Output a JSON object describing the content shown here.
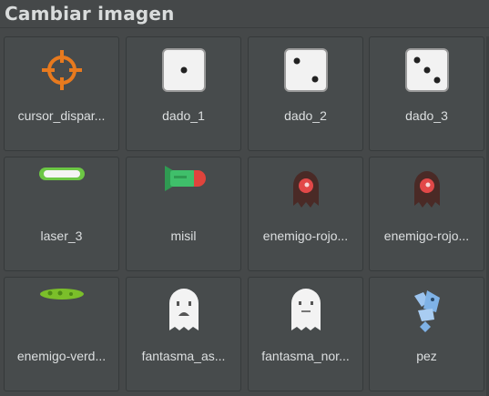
{
  "dialog": {
    "title": "Cambiar imagen"
  },
  "assets": [
    {
      "label": "cursor_dispar...",
      "icon": "crosshair-icon"
    },
    {
      "label": "dado_1",
      "icon": "die-one-icon"
    },
    {
      "label": "dado_2",
      "icon": "die-two-icon"
    },
    {
      "label": "dado_3",
      "icon": "die-three-icon"
    },
    {
      "label": "laser_3",
      "icon": "laser-icon"
    },
    {
      "label": "misil",
      "icon": "missile-icon"
    },
    {
      "label": "enemigo-rojo...",
      "icon": "red-enemy-icon"
    },
    {
      "label": "enemigo-rojo...",
      "icon": "red-enemy-icon"
    },
    {
      "label": "enemigo-verd...",
      "icon": "green-enemy-icon"
    },
    {
      "label": "fantasma_as...",
      "icon": "scared-ghost-icon"
    },
    {
      "label": "fantasma_nor...",
      "icon": "ghost-icon"
    },
    {
      "label": "pez",
      "icon": "fish-icon"
    }
  ],
  "colors": {
    "background": "#454849",
    "tile": "#474b4c",
    "crosshair": "#e87a1e",
    "laser_green": "#6cc644",
    "missile_green": "#3fbf6a",
    "missile_red": "#e0443c",
    "enemy_body": "#4a2a26",
    "enemy_eye": "#e24848",
    "green_enemy": "#7bbf2a",
    "fish": "#7fb2e6"
  }
}
